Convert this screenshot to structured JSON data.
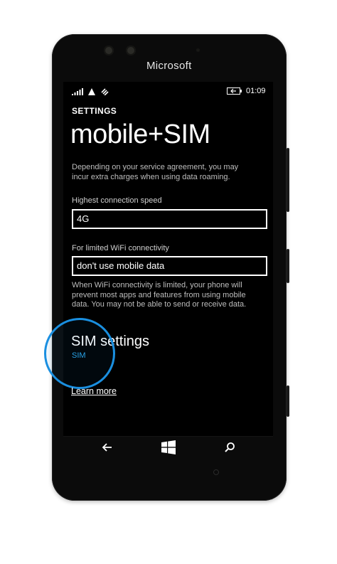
{
  "device": {
    "brand": "Microsoft"
  },
  "status_bar": {
    "time": "01:09"
  },
  "page": {
    "section": "SETTINGS",
    "title": "mobile+SIM",
    "roaming_note": [
      "Depending on your service agreement, you may",
      "incur extra charges when using data roaming."
    ],
    "connection_speed": {
      "label": "Highest connection speed",
      "value": "4G"
    },
    "wifi_limited": {
      "label": "For limited WiFi connectivity",
      "value": "don't use mobile data"
    },
    "wifi_note": [
      "When WiFi connectivity is limited, your phone will",
      "prevent most apps and features from using mobile",
      "data. You may not be able to send or receive data."
    ],
    "sim_settings": {
      "title": "SIM settings",
      "subtitle": "SIM"
    },
    "learn_more": "Learn more"
  },
  "icons": {
    "signal": "signal-bars-icon",
    "data": "data-triangle-icon",
    "wifi": "wifi-icon",
    "battery": "battery-charging-icon",
    "back": "back-arrow-icon",
    "windows": "windows-logo-icon",
    "search": "search-icon"
  },
  "colors": {
    "accent": "#2aa3e6",
    "highlight_ring": "#1a8fe0",
    "background": "#000000"
  }
}
